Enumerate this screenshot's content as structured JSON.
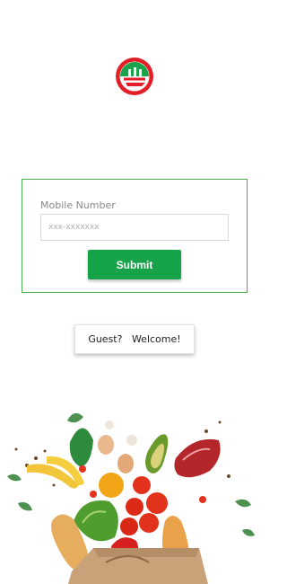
{
  "brand": {
    "logo_icon": "brand-logo-icon",
    "logo_colors": {
      "primary": "#e41e26",
      "secondary": "#1aa34a"
    }
  },
  "login": {
    "field_label": "Mobile Number",
    "field_placeholder": "xxx-xxxxxxx",
    "field_value": "",
    "submit_label": "Submit"
  },
  "guest": {
    "label": "Guest?   Welcome!"
  },
  "hero": {
    "image_icon": "grocery-bag-illustration"
  },
  "colors": {
    "accent": "#16a34a",
    "card_border": "#4caf50"
  }
}
